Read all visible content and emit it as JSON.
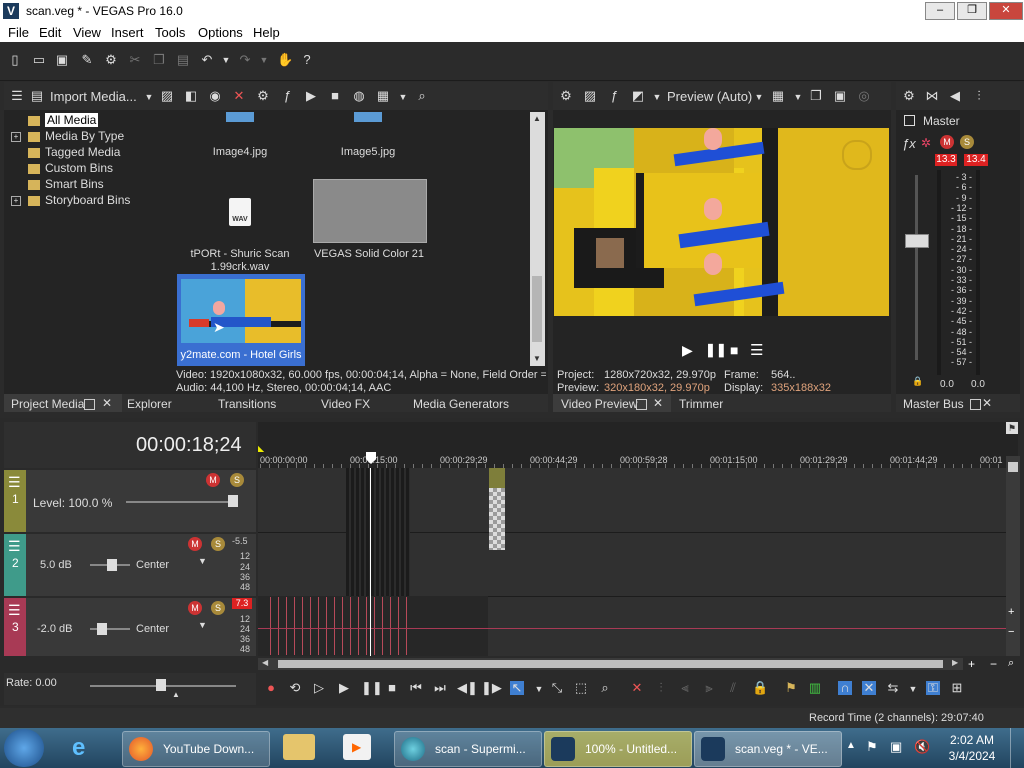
{
  "window": {
    "title": "scan.veg * - VEGAS Pro 16.0",
    "app_icon": "V",
    "minimize": "–",
    "maximize": "❐",
    "close": "✕"
  },
  "menu": [
    "File",
    "Edit",
    "View",
    "Insert",
    "Tools",
    "Options",
    "Help"
  ],
  "media_toolbar": {
    "import_label": "Import Media..."
  },
  "tree": [
    "All Media",
    "Media By Type",
    "Tagged Media",
    "Custom Bins",
    "Smart Bins",
    "Storyboard Bins"
  ],
  "media": {
    "items": [
      "Image4.jpg",
      "Image5.jpg",
      "tPORt - Shuric Scan 1.99crk.wav",
      "VEGAS Solid Color 21",
      "y2mate.com - Hotel Girls"
    ],
    "wav_badge": "WAV",
    "info_video": "Video: 1920x1080x32, 60.000 fps, 00:00:04;14, Alpha = None, Field Order =",
    "info_audio": "Audio: 44,100 Hz, Stereo, 00:00:04;14, AAC"
  },
  "left_tabs": [
    "Project Media",
    "Explorer",
    "Transitions",
    "Video FX",
    "Media Generators"
  ],
  "preview": {
    "mode": "Preview (Auto)",
    "project_label": "Project:",
    "project_value": "1280x720x32, 29.970p",
    "frame_label": "Frame:",
    "frame_value": "564..",
    "preview_label": "Preview:",
    "preview_value": "320x180x32, 29.970p",
    "display_label": "Display:",
    "display_value": "335x188x32",
    "tabs": [
      "Video Preview",
      "Trimmer"
    ]
  },
  "master": {
    "title": "Master",
    "peak_left": "13.3",
    "peak_right": "13.4",
    "scale": [
      "3",
      "6",
      "9",
      "12",
      "15",
      "18",
      "21",
      "24",
      "27",
      "30",
      "33",
      "36",
      "39",
      "42",
      "45",
      "48",
      "51",
      "54",
      "57"
    ],
    "readout_left": "0.0",
    "readout_right": "0.0",
    "tab": "Master Bus"
  },
  "timeline": {
    "timecode": "00:00:18;24",
    "ruler": [
      "00:00:00;00",
      "00:00:15:00",
      "00:00:29;29",
      "00:00:44;29",
      "00:00:59;28",
      "00:01:15;00",
      "00:01:29;29",
      "00:01:44;29",
      "00:01"
    ],
    "tracks": [
      {
        "number": "1",
        "label": "Level: 100.0 %",
        "color": "#8a8a3a"
      },
      {
        "number": "2",
        "volume": "5.0 dB",
        "pan": "Center",
        "peak": "-5.5",
        "scale": [
          "12",
          "24",
          "36",
          "48"
        ],
        "color": "#3f9b8a"
      },
      {
        "number": "3",
        "volume": "-2.0 dB",
        "pan": "Center",
        "peak": "7.3",
        "scale": [
          "12",
          "24",
          "36",
          "48"
        ],
        "color": "#a83a55"
      }
    ],
    "rate": "Rate: 0.00",
    "record_time": "Record Time (2 channels): 29:07:40"
  },
  "taskbar": {
    "items": [
      "YouTube Down...",
      "scan - Supermi...",
      "100% - Untitled...",
      "scan.veg * - VE..."
    ],
    "time": "2:02 AM",
    "date": "3/4/2024"
  }
}
